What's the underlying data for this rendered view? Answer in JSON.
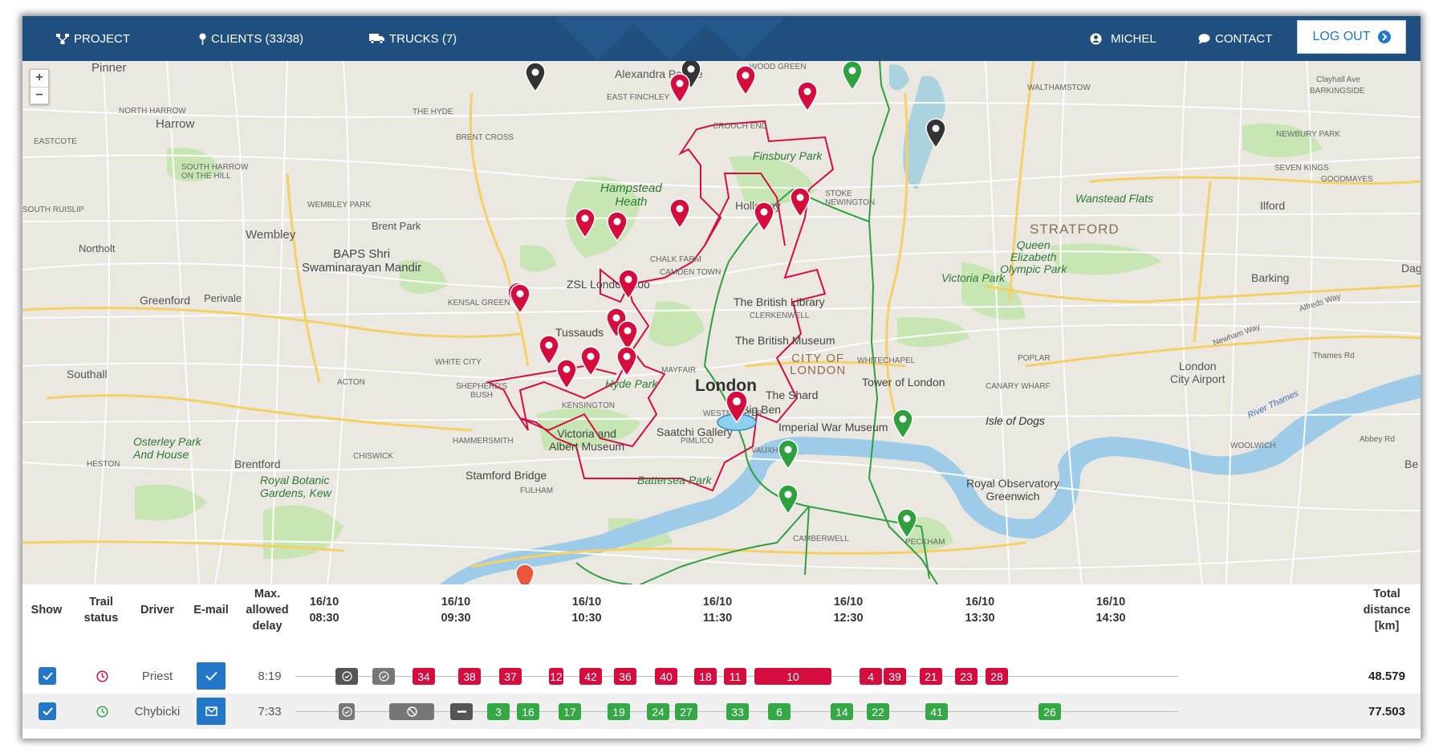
{
  "colors": {
    "nav_bg": "#1f4f7f",
    "accent_blue": "#2277c8",
    "route_red": "#d50c3e",
    "route_green": "#33a845",
    "completed_gray": "#555555"
  },
  "nav": {
    "project_label": "PROJECT",
    "clients_label": "CLIENTS (33/38)",
    "trucks_label": "TRUCKS (7)",
    "user_label": "MICHEL",
    "contact_label": "CONTACT",
    "logout_label": "LOG OUT",
    "icons": {
      "project": "sitemap-icon",
      "clients": "map-pin-icon",
      "trucks": "truck-icon",
      "user": "user-icon",
      "contact": "chat-bubble-icon",
      "logout": "chevron-right-circle-icon"
    }
  },
  "map": {
    "zoom_in": "+",
    "zoom_out": "−",
    "labels": {
      "pinner": "Pinner",
      "harrow": "Harrow",
      "north_harrow": "NORTH HARROW",
      "eastcote": "EASTCOTE",
      "south_harrow": "SOUTH HARROW\nON THE HILL",
      "south_ruislip": "SOUTH RUISLIP",
      "wembley": "Wembley",
      "wembley_park": "WEMBLEY PARK",
      "brent_park": "Brent Park",
      "northolt": "Northolt",
      "baps": "BAPS Shri\nSwaminarayan Mandir",
      "greenford": "Greenford",
      "perivale": "Perivale",
      "southall": "Southall",
      "osterley": "Osterley Park\nAnd House",
      "brentford": "Brentford",
      "kew": "Royal Botanic\nGardens, Kew",
      "hanwell": "HESTON",
      "chiswick": "CHISWICK",
      "acton": "ACTON",
      "shepherds_bush": "SHEPHERD'S\nBUSH",
      "white_city": "WHITE CITY",
      "kensal_green": "KENSAL GREEN",
      "hammersmith": "HAMMERSMITH",
      "fulham": "FULHAM",
      "stamford_bridge": "Stamford Bridge",
      "the_hyde": "THE HYDE",
      "brent_cross": "BRENT CROSS",
      "alexandra": "Alexandra Palace",
      "wood_green": "WOOD GREEN",
      "east_finchley": "EAST FINCHLEY",
      "crouch_end": "CROUCH END",
      "hampstead": "Hampstead\nHeath",
      "finsbury_park": "Finsbury Park",
      "holloway": "Holloway",
      "stoke_newington": "STOKE\nNEWINGTON",
      "chalk_farm": "CHALK FARM",
      "camden": "CAMDEN TOWN",
      "zsl": "ZSL London Zoo",
      "tussauds": "Tussauds",
      "british_library": "The British Library",
      "clerkenwell": "CLERKENWELL",
      "british_museum": "The British Museum",
      "mayfair": "MAYFAIR",
      "hyde_park": "Hyde Park",
      "kensington": "KENSINGTON",
      "london": "London",
      "city": "CITY OF\nLONDON",
      "tower": "Tower of London",
      "shard": "The Shard",
      "big_ben": "Big Ben",
      "iwm": "Imperial War Museum",
      "va": "Victoria and\nAlbert Museum",
      "saatchi": "Saatchi Gallery",
      "battersea": "Battersea Park",
      "vauxhall": "VAUXHALL",
      "pimlico": "PIMLICO",
      "whitechapel": "WHITECHAPEL",
      "stratford": "STRATFORD",
      "qeop": "Queen\nElizabeth\nOlympic Park",
      "victoria_park": "Victoria Park",
      "wanstead": "Wanstead Flats",
      "ilford": "Ilford",
      "barking": "Barking",
      "walthamstow": "WALTHAMSTOW",
      "barkingside": "BARKINGSIDE",
      "newbury_park": "NEWBURY PARK",
      "seven_kings": "SEVEN KINGS",
      "goodmayes": "GOODMAYES",
      "poplar": "POPLAR",
      "canary": "CANARY WHARF",
      "isle_of_dogs": "Isle of Dogs",
      "city_airport": "London\nCity Airport",
      "woolwich": "WOOLWICH",
      "greenwich": "Royal Observatory\nGreenwich",
      "river_thames": "River Thames",
      "thames_rd": "Thames Rd",
      "newham_way": "Newham Way",
      "alfreds_way": "Alfreds Way",
      "dag": "Dag",
      "be": "Be",
      "abbey_rd": "Abbey Rd",
      "clayhall": "Clayhall Ave",
      "peckham": "PECKHAM",
      "camberwell": "CAMBERWELL",
      "westminster": "WESTMINSTER"
    }
  },
  "schedule": {
    "headers": {
      "show": "Show",
      "trail_status": "Trail\nstatus",
      "driver": "Driver",
      "email": "E-mail",
      "max_delay": "Max.\nallowed\ndelay",
      "total": "Total\ndistance\n[km]"
    },
    "time_headers": [
      "16/10\n08:30",
      "16/10\n09:30",
      "16/10\n10:30",
      "16/10\n11:30",
      "16/10\n12:30",
      "16/10\n13:30",
      "16/10\n14:30"
    ],
    "rows": [
      {
        "driver": "Priest",
        "max_delay": "8:19",
        "total": "48.579",
        "status_color": "#d50c3e",
        "email_icon": "check-icon",
        "stops": [
          "check",
          "check",
          "34",
          "38",
          "37",
          "12",
          "42",
          "36",
          "40",
          "18",
          "11",
          "10",
          "4",
          "39",
          "21",
          "23",
          "28"
        ]
      },
      {
        "driver": "Chybicki",
        "max_delay": "7:33",
        "total": "77.503",
        "status_color": "#33a845",
        "email_icon": "envelope-icon",
        "stops": [
          "check",
          "blocked",
          "minus",
          "3",
          "16",
          "17",
          "19",
          "24",
          "27",
          "33",
          "6",
          "14",
          "22",
          "41",
          "26"
        ]
      }
    ]
  }
}
